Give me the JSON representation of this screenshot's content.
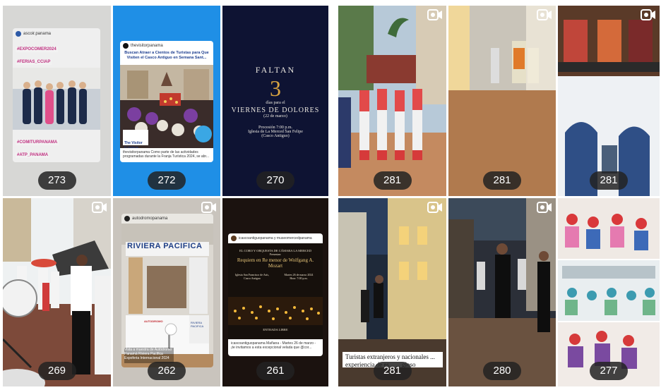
{
  "left_grid": [
    {
      "views": "273",
      "handle": "ascoir.panama",
      "tags": [
        "#EXPOCOMER2024",
        "#FERIAS_CCIAP",
        "#COMITURPANAMA",
        "#ATP_PANAMA"
      ]
    },
    {
      "views": "272",
      "handle": "thevisitorpanama",
      "headline": "Buscan Atraer a Cientos de Turistas para Que Visiten el Casco Antiguo en Semana Sant...",
      "logo_line1": "The Visitor",
      "logo_line2": "El Visitante",
      "caption": "thevisitorpanama Como parte de las actividades programadas durante la Franja Turística 2024, se abr..."
    },
    {
      "views": "270",
      "faltan": "FALTAN",
      "number": "3",
      "dias": "días para el",
      "event": "VIERNES DE DOLORES",
      "date": "(22 de marzo)",
      "procesion": "Procesión 7:00 p.m.",
      "iglesia": "Iglesia de La Merced San Felipe",
      "casco": "(Casco Antiguo)"
    },
    {
      "views": "269",
      "reel": true
    },
    {
      "views": "262",
      "handle": "autodromopanama",
      "brand": "RIVIERA PACIFICA",
      "logo_a": "AUTODROMO",
      "logo_b": "RIVIERA PACIFICA",
      "note": "Vista a muestra de Autódromo Panamá Riviera Pacífica Expoferia Internacional 2024",
      "reel": true
    },
    {
      "views": "261",
      "handle": "icascoantiguopanama y museomercedpanama",
      "org": "EL CORO Y ORQUESTA DE CÁMARA LA MERCED",
      "presenta": "Presentan:",
      "title": "Requiem en Re menor de Wolfgang A. Mozart",
      "venue": "Iglesia San Francisco de Asís, Casco Antiguo",
      "when": "Martes 26 de marzo 2024 Hora: 7:00 p.m.",
      "entrada": "ENTRADA LIBRE",
      "caption": "icascoantiguopanama Mañana - Martes 26 de marzo - ¡te invitamos a esta excepcional velada que @cor..."
    }
  ],
  "right_grid": [
    {
      "views": "281",
      "reel": true
    },
    {
      "views": "281",
      "reel": true
    },
    {
      "views": "281",
      "reel": true
    },
    {
      "views": "281",
      "reel": true,
      "overlay": "Turistas extranjeros y nacionales ... experiencia de es... ... gioso"
    },
    {
      "views": "280",
      "reel": true
    },
    {
      "views": "277",
      "reel": false
    }
  ],
  "colors": {
    "badge_bg": "#222222",
    "badge_text": "#ffffff",
    "accent_blue": "#1f8fe6",
    "night_navy": "#0e1333",
    "gold": "#d9a441"
  }
}
